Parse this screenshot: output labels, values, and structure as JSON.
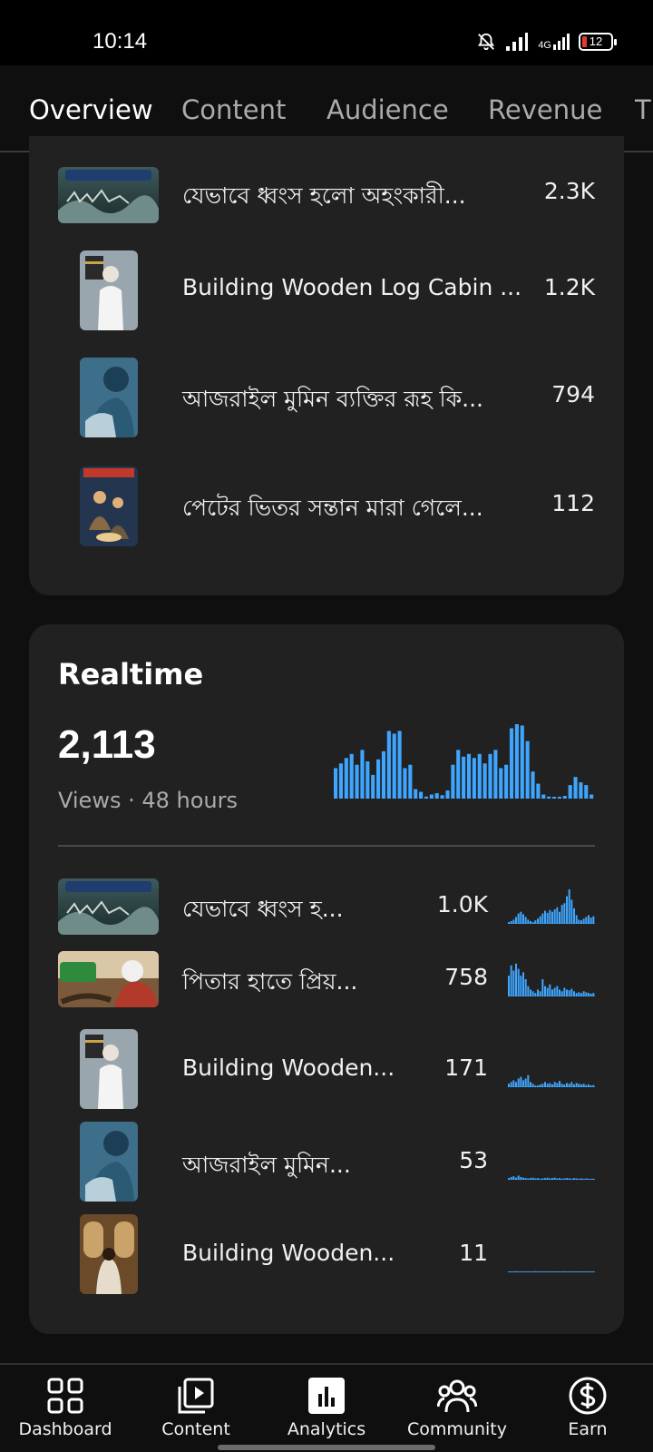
{
  "status_bar": {
    "time": "10:14",
    "network": "4G",
    "battery": "12",
    "icons": [
      "mute-icon",
      "signal-icon",
      "signal-4g-icon",
      "battery-icon"
    ]
  },
  "tabs": [
    {
      "label": "Overview",
      "active": true
    },
    {
      "label": "Content",
      "active": false
    },
    {
      "label": "Audience",
      "active": false
    },
    {
      "label": "Revenue",
      "active": false
    },
    {
      "label": "T",
      "active": false
    }
  ],
  "top_content": [
    {
      "title": "যেভাবে ধ্বংস হলো অহংকারী...",
      "value": "2.3K"
    },
    {
      "title": "Building Wooden Log Cabin ...",
      "value": "1.2K"
    },
    {
      "title": "আজরাইল মুমিন ব্যক্তির রূহ কি...",
      "value": "794"
    },
    {
      "title": "পেটের ভিতর সন্তান মারা গেলে...",
      "value": "112"
    }
  ],
  "realtime": {
    "title": "Realtime",
    "views": "2,113",
    "caption": "Views · 48 hours",
    "chart_color": "#3ea6ff",
    "bars": [
      0.45,
      0.52,
      0.6,
      0.66,
      0.5,
      0.72,
      0.55,
      0.35,
      0.58,
      0.7,
      1.0,
      0.96,
      1.0,
      0.45,
      0.5,
      0.14,
      0.1,
      0.03,
      0.06,
      0.08,
      0.05,
      0.12,
      0.5,
      0.72,
      0.62,
      0.66,
      0.6,
      0.66,
      0.52,
      0.66,
      0.72,
      0.45,
      0.5,
      1.04,
      1.1,
      1.08,
      0.85,
      0.4,
      0.22,
      0.06,
      0.03,
      0.02,
      0.02,
      0.04,
      0.2,
      0.32,
      0.24,
      0.2,
      0.06
    ],
    "rows": [
      {
        "title": "যেভাবে ধ্বংস হ...",
        "value": "1.0K",
        "spark": [
          0.05,
          0.08,
          0.12,
          0.2,
          0.3,
          0.35,
          0.28,
          0.2,
          0.12,
          0.08,
          0.05,
          0.1,
          0.15,
          0.22,
          0.3,
          0.38,
          0.32,
          0.4,
          0.35,
          0.42,
          0.48,
          0.35,
          0.55,
          0.6,
          0.8,
          1.0,
          0.7,
          0.45,
          0.25,
          0.12,
          0.1,
          0.15,
          0.2,
          0.25,
          0.18,
          0.22
        ]
      },
      {
        "title": "পিতার হাতে প্রিয়...",
        "value": "758",
        "spark": [
          0.6,
          0.9,
          0.75,
          0.95,
          0.8,
          0.6,
          0.7,
          0.5,
          0.3,
          0.2,
          0.15,
          0.1,
          0.2,
          0.15,
          0.5,
          0.3,
          0.25,
          0.35,
          0.2,
          0.25,
          0.3,
          0.2,
          0.15,
          0.25,
          0.2,
          0.18,
          0.22,
          0.15,
          0.1,
          0.12,
          0.1,
          0.15,
          0.12,
          0.1,
          0.08,
          0.1
        ]
      },
      {
        "title": "Building Wooden...",
        "value": "171",
        "spark": [
          0.1,
          0.15,
          0.2,
          0.15,
          0.25,
          0.3,
          0.2,
          0.25,
          0.35,
          0.15,
          0.1,
          0.05,
          0.05,
          0.08,
          0.1,
          0.15,
          0.1,
          0.12,
          0.08,
          0.15,
          0.12,
          0.18,
          0.1,
          0.08,
          0.12,
          0.1,
          0.15,
          0.08,
          0.12,
          0.1,
          0.08,
          0.1,
          0.06,
          0.08,
          0.05,
          0.06
        ]
      },
      {
        "title": "আজরাইল মুমিন...",
        "value": "53",
        "spark": [
          0.05,
          0.08,
          0.1,
          0.06,
          0.12,
          0.08,
          0.06,
          0.05,
          0.04,
          0.05,
          0.06,
          0.04,
          0.05,
          0.03,
          0.04,
          0.05,
          0.06,
          0.04,
          0.05,
          0.06,
          0.04,
          0.05,
          0.03,
          0.04,
          0.05,
          0.04,
          0.03,
          0.05,
          0.04,
          0.03,
          0.04,
          0.03,
          0.04,
          0.03,
          0.02,
          0.03
        ]
      },
      {
        "title": "Building Wooden...",
        "value": "11",
        "spark": [
          0.02,
          0.02,
          0.02,
          0.03,
          0.02,
          0.02,
          0.02,
          0.02,
          0.02,
          0.02,
          0.02,
          0.03,
          0.02,
          0.02,
          0.02,
          0.02,
          0.02,
          0.02,
          0.02,
          0.02,
          0.02,
          0.02,
          0.02,
          0.03,
          0.02,
          0.02,
          0.02,
          0.02,
          0.02,
          0.02,
          0.02,
          0.02,
          0.02,
          0.02,
          0.02,
          0.02
        ]
      }
    ]
  },
  "bottom_nav": [
    {
      "label": "Dashboard",
      "icon": "dashboard-icon"
    },
    {
      "label": "Content",
      "icon": "content-icon"
    },
    {
      "label": "Analytics",
      "icon": "analytics-icon",
      "active": true
    },
    {
      "label": "Community",
      "icon": "community-icon"
    },
    {
      "label": "Earn",
      "icon": "earn-icon"
    }
  ]
}
